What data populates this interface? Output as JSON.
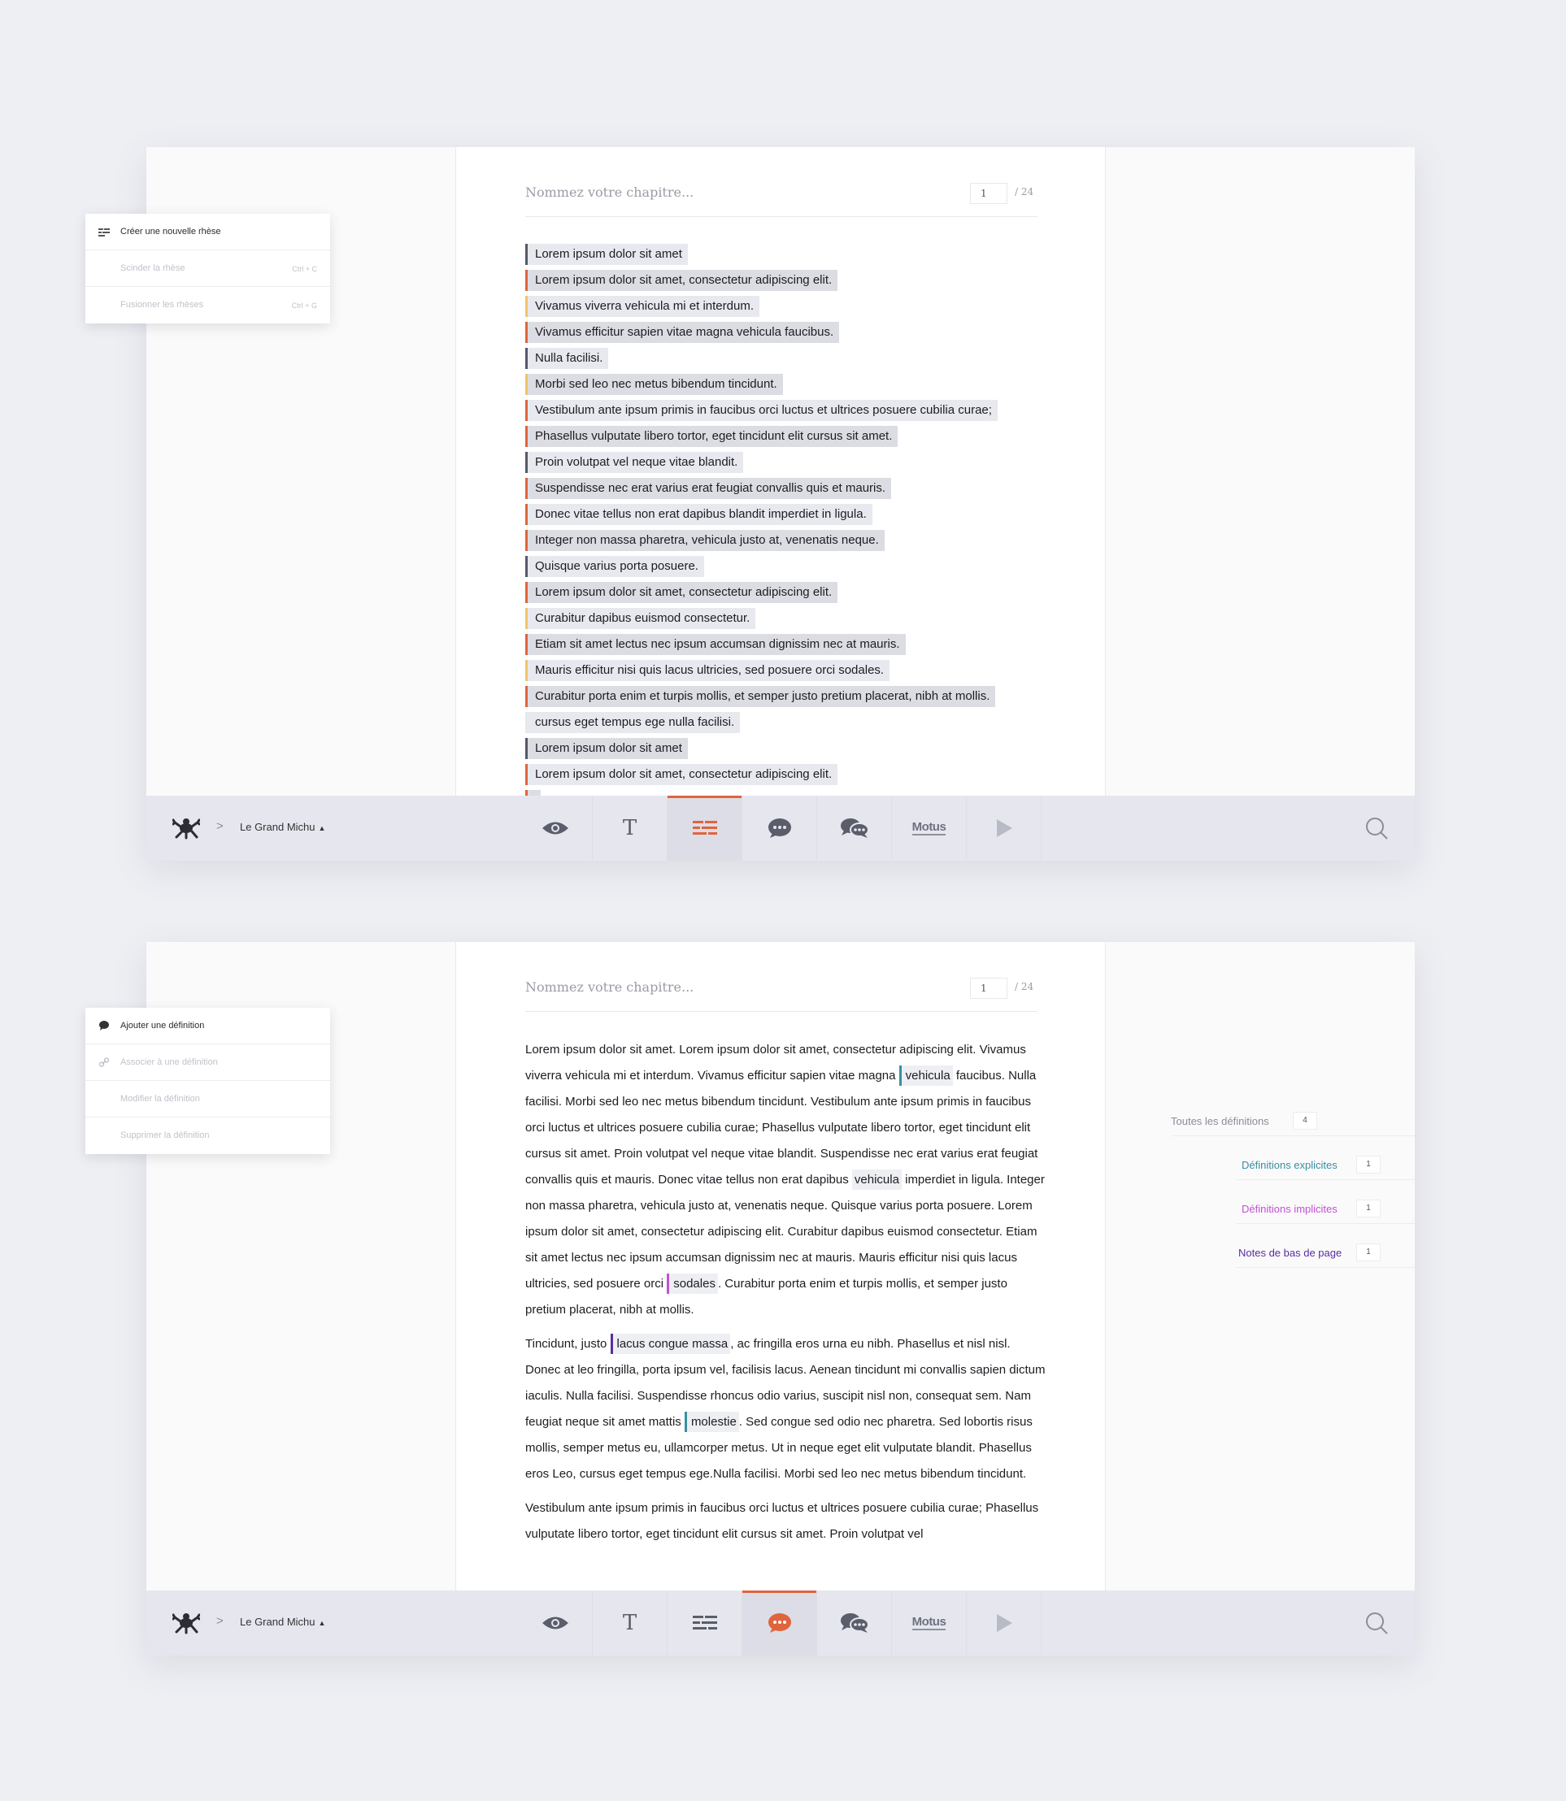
{
  "editor": {
    "chapter_placeholder": "Nommez votre chapitre...",
    "page_current": "1",
    "page_total": "/ 24"
  },
  "toolbar": {
    "doc_name": "Le Grand Michu",
    "crumb_sep": ">",
    "motus_label": "Motus",
    "t_label": "T"
  },
  "menu_rhese": {
    "items": [
      {
        "label": "Créer une nouvelle rhèse",
        "shortcut": ""
      },
      {
        "label": "Scinder la rhèse",
        "shortcut": "Ctrl + C"
      },
      {
        "label": "Fusionner les rhèses",
        "shortcut": "Ctrl + G"
      }
    ]
  },
  "menu_def": {
    "items": [
      {
        "label": "Ajouter une définition"
      },
      {
        "label": "Associer à une définition"
      },
      {
        "label": "Modifier la définition"
      },
      {
        "label": "Supprimer la définition"
      }
    ]
  },
  "rheses": [
    {
      "text": "Lorem ipsum dolor sit amet",
      "color": "grey"
    },
    {
      "text": "Lorem ipsum dolor sit amet, consectetur adipiscing elit.",
      "color": "orange"
    },
    {
      "text": "Vivamus viverra vehicula mi et interdum.",
      "color": "yellow"
    },
    {
      "text": "Vivamus efficitur sapien vitae magna vehicula faucibus.",
      "color": "orange"
    },
    {
      "text": "Nulla facilisi.",
      "color": "grey"
    },
    {
      "text": "Morbi sed leo nec metus bibendum tincidunt.",
      "color": "yellow"
    },
    {
      "text": "Vestibulum ante ipsum primis in faucibus orci luctus et ultrices posuere cubilia curae;",
      "color": "orange"
    },
    {
      "text": "Phasellus vulputate libero tortor, eget tincidunt elit cursus sit amet.",
      "color": "orange"
    },
    {
      "text": "Proin volutpat vel neque vitae blandit.",
      "color": "grey"
    },
    {
      "text": "Suspendisse nec erat varius erat feugiat convallis quis et mauris.",
      "color": "orange"
    },
    {
      "text": "Donec vitae tellus non erat dapibus blandit imperdiet in ligula.",
      "color": "orange"
    },
    {
      "text": "Integer non massa pharetra, vehicula justo at, venenatis neque.",
      "color": "orange"
    },
    {
      "text": "Quisque varius porta posuere.",
      "color": "grey"
    },
    {
      "text": "Lorem ipsum dolor sit amet, consectetur adipiscing elit.",
      "color": "orange"
    },
    {
      "text": "Curabitur dapibus euismod consectetur.",
      "color": "yellow"
    },
    {
      "text": "Etiam sit amet lectus nec ipsum accumsan dignissim nec at mauris.",
      "color": "orange"
    },
    {
      "text": "Mauris efficitur nisi quis lacus ultricies, sed posuere orci sodales.",
      "color": "yellow"
    },
    {
      "text": "Curabitur porta enim et turpis mollis, et semper justo pretium placerat, nibh at mollis.",
      "color": "orange"
    },
    {
      "text": "cursus eget tempus ege nulla facilisi.",
      "color": "none"
    },
    {
      "text": "Lorem ipsum dolor sit amet",
      "color": "grey"
    },
    {
      "text": "Lorem ipsum dolor sit amet, consectetur adipiscing elit.",
      "color": "orange"
    },
    {
      "text": "",
      "color": "orange"
    }
  ],
  "prose": {
    "p1": [
      "Lorem ipsum dolor sit amet. Lorem ipsum dolor sit amet, consectetur adipiscing elit. Vivamus viverra vehicula mi et interdum. Vivamus efficitur sapien vitae magna ",
      "vehicula",
      " faucibus. Nulla facilisi. Morbi sed leo nec metus bibendum tincidunt. Vestibulum ante ipsum primis in faucibus orci luctus et ultrices posuere cubilia curae; Phasellus vulputate libero tortor, eget tincidunt elit cursus sit amet. Proin volutpat vel neque vitae blandit. Suspendisse nec erat varius erat feugiat convallis quis et mauris. Donec vitae tellus non erat dapibus ",
      "vehicula",
      " imperdiet in ligula. Integer non massa pharetra, vehicula justo at, venenatis neque. Quisque varius porta posuere. Lorem ipsum dolor sit amet, consectetur adipiscing elit. Curabitur dapibus euismod consectetur. Etiam sit amet lectus nec ipsum accumsan dignissim nec at mauris. Mauris efficitur nisi quis lacus ultricies, sed posuere orci ",
      "sodales",
      ". Curabitur porta enim et turpis mollis, et semper justo pretium placerat, nibh at mollis."
    ],
    "p2": [
      "Tincidunt, justo ",
      "lacus congue massa",
      ", ac fringilla eros urna eu nibh. Phasellus et nisl nisl. Donec at leo fringilla, porta ipsum vel, facilisis lacus. Aenean tincidunt mi convallis sapien dictum iaculis. Nulla facilisi. Suspendisse rhoncus odio varius, suscipit nisl non, consequat sem. Nam feugiat neque sit amet mattis ",
      "molestie",
      ". Sed congue sed odio nec pharetra. Sed lobortis risus mollis, semper metus eu, ullamcorper metus. Ut in neque eget elit vulputate blandit. Phasellus eros Leo, cursus eget tempus ege.Nulla facilisi. Morbi sed leo nec metus bibendum tincidunt."
    ],
    "p3": "Vestibulum ante ipsum primis in faucibus orci luctus et ultrices posuere cubilia curae; Phasellus vulputate libero tortor, eget tincidunt elit cursus sit amet. Proin volutpat vel"
  },
  "definitions": {
    "all": {
      "label": "Toutes les définitions",
      "count": "4"
    },
    "items": [
      {
        "label": "Définitions explicites",
        "count": "1",
        "color": "#3a8fa0"
      },
      {
        "label": "Définitions implicites",
        "count": "1",
        "color": "#c44fd6"
      },
      {
        "label": "Notes de bas de page",
        "count": "1",
        "color": "#5a2ea0"
      }
    ]
  },
  "colors": {
    "accent": "#e0643c",
    "rhese_orange": "#e0643c",
    "rhese_yellow": "#f0c46a",
    "rhese_grey": "#55576a"
  }
}
